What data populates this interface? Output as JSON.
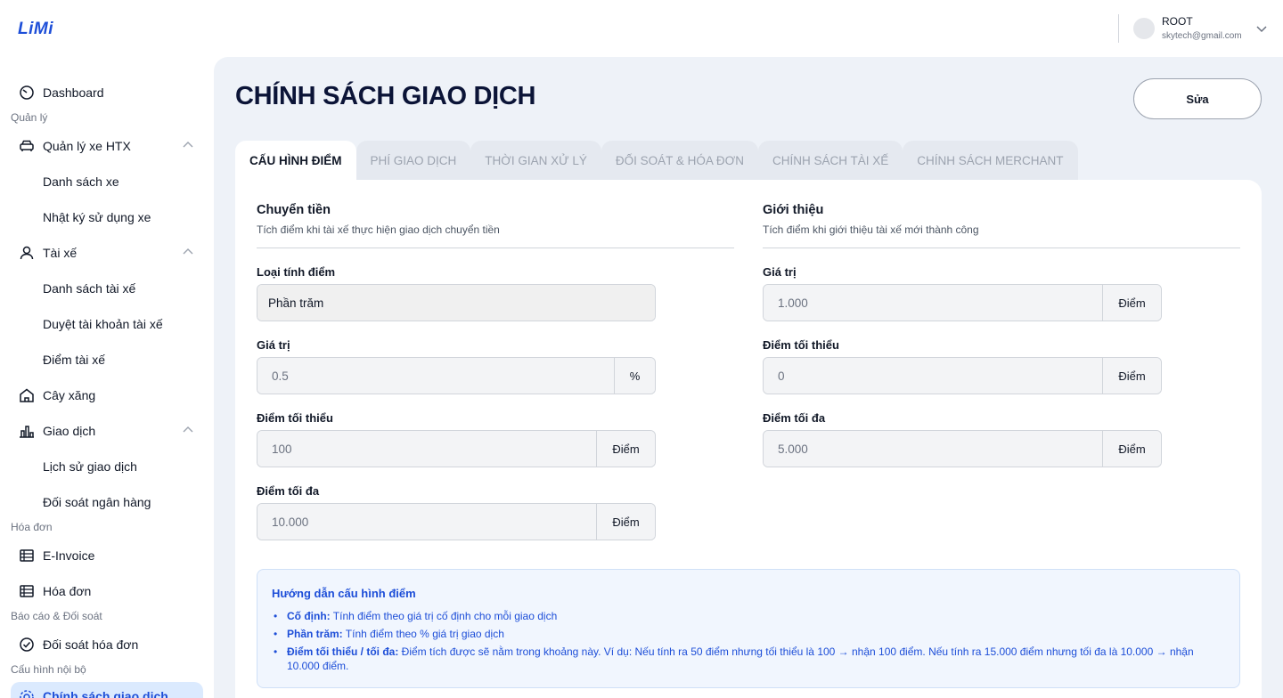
{
  "brand": {
    "logo": "LiMi"
  },
  "user": {
    "name": "ROOT",
    "email": "skytech@gmail.com"
  },
  "sidebar": {
    "dashboard": "Dashboard",
    "sections": {
      "manage": "Quản lý",
      "invoice": "Hóa đơn",
      "report": "Báo cáo & Đối soát",
      "config": "Cấu hình nội bộ"
    },
    "vehicles": {
      "label": "Quản lý xe HTX",
      "items": [
        "Danh sách xe",
        "Nhật ký sử dụng xe"
      ]
    },
    "drivers": {
      "label": "Tài xế",
      "items": [
        "Danh sách tài xế",
        "Duyệt tài khoản tài xế",
        "Điểm tài xế"
      ]
    },
    "gas": "Cây xăng",
    "transactions": {
      "label": "Giao dịch",
      "items": [
        "Lịch sử giao dịch",
        "Đối soát ngân hàng"
      ]
    },
    "einvoice": "E-Invoice",
    "invoice": "Hóa đơn",
    "reconcile": "Đối soát hóa đơn",
    "active": "Chính sách giao dịch"
  },
  "page": {
    "title": "CHÍNH SÁCH GIAO DỊCH",
    "edit_label": "Sửa",
    "tabs": [
      "CẤU HÌNH ĐIỂM",
      "PHÍ GIAO DỊCH",
      "THỜI GIAN XỬ LÝ",
      "ĐỐI SOÁT & HÓA ĐƠN",
      "CHÍNH SÁCH TÀI XẾ",
      "CHÍNH SÁCH MERCHANT"
    ]
  },
  "transfer": {
    "title": "Chuyển tiền",
    "desc": "Tích điểm khi tài xế thực hiện giao dịch chuyển tiền",
    "type_label": "Loại tính điểm",
    "type_value": "Phần trăm",
    "value_label": "Giá trị",
    "value": "0.5",
    "value_unit": "%",
    "min_label": "Điểm tối thiểu",
    "min": "100",
    "min_unit": "Điểm",
    "max_label": "Điểm tối đa",
    "max": "10.000",
    "max_unit": "Điểm"
  },
  "referral": {
    "title": "Giới thiệu",
    "desc": "Tích điểm khi giới thiệu tài xế mới thành công",
    "value_label": "Giá trị",
    "value": "1.000",
    "value_unit": "Điểm",
    "min_label": "Điểm tối thiểu",
    "min": "0",
    "min_unit": "Điểm",
    "max_label": "Điểm tối đa",
    "max": "5.000",
    "max_unit": "Điểm"
  },
  "guide": {
    "title": "Hướng dẫn cấu hình điểm",
    "items": [
      {
        "term": "Cố định:",
        "text": " Tính điểm theo giá trị cố định cho mỗi giao dịch"
      },
      {
        "term": "Phần trăm:",
        "text": " Tính điểm theo % giá trị giao dịch"
      },
      {
        "term": "Điểm tối thiểu / tối đa:",
        "text": " Điểm tích được sẽ nằm trong khoảng này. Ví dụ: Nếu tính ra 50 điểm nhưng tối thiểu là 100 → nhận 100 điểm. Nếu tính ra 15.000 điểm nhưng tối đa là 10.000 → nhận 10.000 điểm."
      }
    ]
  }
}
